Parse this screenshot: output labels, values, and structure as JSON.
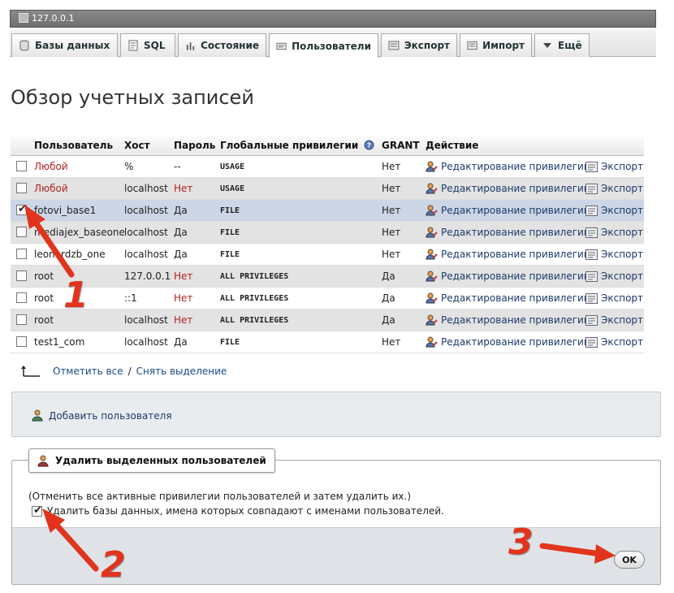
{
  "window": {
    "title": "127.0.0.1"
  },
  "tabs": [
    {
      "label": "Базы данных",
      "icon": "database-icon"
    },
    {
      "label": "SQL",
      "icon": "sql-icon"
    },
    {
      "label": "Состояние",
      "icon": "status-icon"
    },
    {
      "label": "Пользователи",
      "icon": "users-icon"
    },
    {
      "label": "Экспорт",
      "icon": "export-icon"
    },
    {
      "label": "Импорт",
      "icon": "import-icon"
    },
    {
      "label": "Ещё",
      "icon": "chevron-down-icon"
    }
  ],
  "page": {
    "title": "Обзор учетных записей"
  },
  "table": {
    "headers": {
      "user": "Пользователь",
      "host": "Хост",
      "password": "Пароль",
      "privileges": "Глобальные привилегии",
      "grant": "GRANT",
      "action": "Действие"
    },
    "edit_label": "Редактирование привилегий",
    "export_label": "Экспорт",
    "rows": [
      {
        "user": "Любой",
        "host": "%",
        "password": "--",
        "privileges": "USAGE",
        "grant": "Нет",
        "checked": false
      },
      {
        "user": "Любой",
        "host": "localhost",
        "password": "Нет",
        "privileges": "USAGE",
        "grant": "Нет",
        "checked": false
      },
      {
        "user": "fotovi_base1",
        "host": "localhost",
        "password": "Да",
        "privileges": "FILE",
        "grant": "Нет",
        "checked": true
      },
      {
        "user": "mediajex_baseone",
        "host": "localhost",
        "password": "Да",
        "privileges": "FILE",
        "grant": "Нет",
        "checked": false
      },
      {
        "user": "leonardzb_one",
        "host": "localhost",
        "password": "Да",
        "privileges": "FILE",
        "grant": "Нет",
        "checked": false
      },
      {
        "user": "root",
        "host": "127.0.0.1",
        "password": "Нет",
        "privileges": "ALL PRIVILEGES",
        "grant": "Да",
        "checked": false
      },
      {
        "user": "root",
        "host": "::1",
        "password": "Нет",
        "privileges": "ALL PRIVILEGES",
        "grant": "Да",
        "checked": false
      },
      {
        "user": "root",
        "host": "localhost",
        "password": "Нет",
        "privileges": "ALL PRIVILEGES",
        "grant": "Да",
        "checked": false
      },
      {
        "user": "test1_com",
        "host": "localhost",
        "password": "Да",
        "privileges": "FILE",
        "grant": "Нет",
        "checked": false
      }
    ]
  },
  "select": {
    "check_all": "Отметить все",
    "separator": "/",
    "uncheck_all": "Снять выделение"
  },
  "add_user": {
    "label": "Добавить пользователя"
  },
  "delete": {
    "legend": "Удалить выделенных пользователей",
    "note": "(Отменить все активные привилегии пользователей и затем удалить их.)",
    "drop_db_label": "Удалить базы данных, имена которых совпадают с именами пользователей.",
    "drop_db_checked": true,
    "ok_label": "OK"
  },
  "annotations": {
    "step1": "1",
    "step2": "2",
    "step3": "3",
    "color": "#e2341c"
  }
}
